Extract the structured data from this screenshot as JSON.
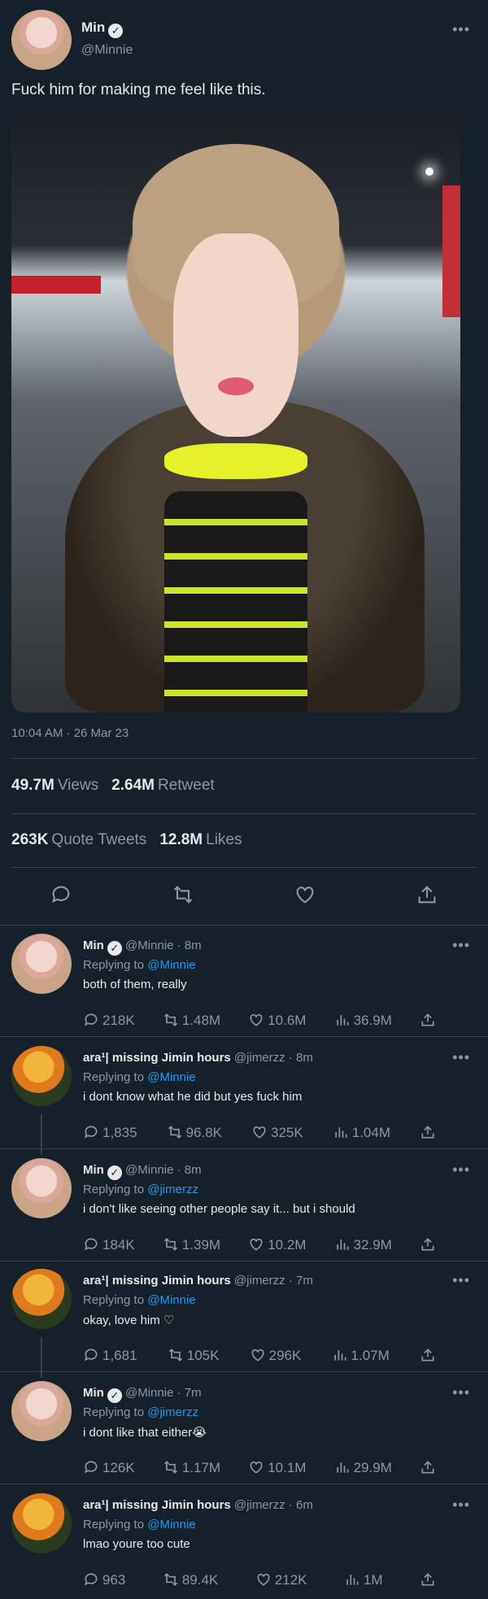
{
  "header": {
    "name": "Min",
    "verified_mark": "✓",
    "handle": "@Minnie",
    "more": "•••"
  },
  "tweet": {
    "text": "Fuck him for making me feel like this.",
    "timestamp": "10:04 AM · 26 Mar 23",
    "views_value": "49.7M",
    "views_label": "Views",
    "retweets_value": "2.64M",
    "retweets_label": "Retweet",
    "quotes_value": "263K",
    "quotes_label": "Quote Tweets",
    "likes_value": "12.8M",
    "likes_label": "Likes"
  },
  "actions": {
    "reply_icon": "reply-icon",
    "retweet_icon": "retweet-icon",
    "like_icon": "heart-icon",
    "share_icon": "share-icon"
  },
  "replies": [
    {
      "name": "Min",
      "verified": true,
      "handle": "@Minnie",
      "time": "8m",
      "replying_to": "@Minnie",
      "text": "both of them, really",
      "replies": "218K",
      "retweets": "1.48M",
      "likes": "10.6M",
      "views": "36.9M"
    },
    {
      "name": "ara¹| missing Jimin hours",
      "verified": false,
      "handle": "@jimerzz",
      "time": "8m",
      "replying_to": "@Minnie",
      "text": "i dont know what he did but yes fuck him",
      "replies": "1,835",
      "retweets": "96.8K",
      "likes": "325K",
      "views": "1.04M"
    },
    {
      "name": "Min",
      "verified": true,
      "handle": "@Minnie",
      "time": "8m",
      "replying_to": "@jimerzz",
      "text": "i don't like seeing other people say it... but i should",
      "replies": "184K",
      "retweets": "1.39M",
      "likes": "10.2M",
      "views": "32.9M"
    },
    {
      "name": "ara¹| missing Jimin hours",
      "verified": false,
      "handle": "@jimerzz",
      "time": "7m",
      "replying_to": "@Minnie",
      "text": "okay, love him ♡",
      "replies": "1,681",
      "retweets": "105K",
      "likes": "296K",
      "views": "1.07M"
    },
    {
      "name": "Min",
      "verified": true,
      "handle": "@Minnie",
      "time": "7m",
      "replying_to": "@jimerzz",
      "text": "i dont like that either😭",
      "replies": "126K",
      "retweets": "1.17M",
      "likes": "10.1M",
      "views": "29.9M"
    },
    {
      "name": "ara¹| missing Jimin hours",
      "verified": false,
      "handle": "@jimerzz",
      "time": "6m",
      "replying_to": "@Minnie",
      "text": "lmao youre too cute",
      "replies": "963",
      "retweets": "89.4K",
      "likes": "212K",
      "views": "1M"
    }
  ],
  "labels": {
    "replying_prefix": "Replying to",
    "dot": "·"
  },
  "colors": {
    "background": "#15202b",
    "text": "#e7e9ea",
    "muted": "#8b98a5",
    "link": "#1d9bf0",
    "divider": "#38444d"
  }
}
